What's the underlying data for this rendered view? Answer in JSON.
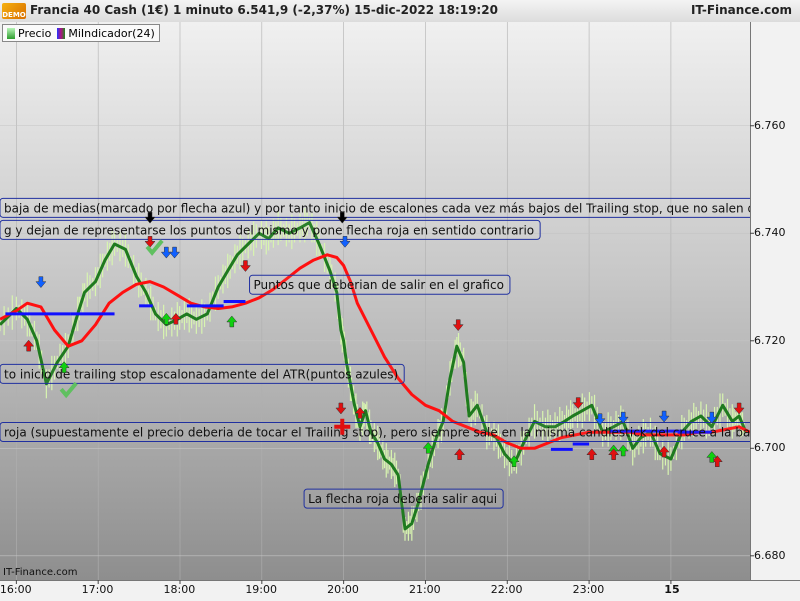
{
  "header": {
    "logo_text": "DEMO",
    "title": "Francia 40 Cash (1€) 1 minuto 6.541,9 (-2,37%) 15-dic-2022 18:19:20",
    "brand": "IT-Finance.com"
  },
  "legend": [
    {
      "label": "Precio",
      "swatch": "price-swatch-icon"
    },
    {
      "label": "MiIndicador(24)",
      "swatch": "indicator-swatch-icon"
    }
  ],
  "watermark": "IT-Finance.com",
  "colors": {
    "price": "#1f7a1f",
    "price_wick": "#d8f5b0",
    "ma": "#ff1010",
    "trailing": "#1010ff",
    "box_border": "#2030a0",
    "sell_arrow": "#e01010",
    "buy_arrow": "#10d010",
    "blue_arrow": "#1060ff"
  },
  "chart_data": {
    "type": "line",
    "title": "Francia 40 Cash (1€) 1 minuto",
    "y_ticks": [
      "6.760",
      "6.740",
      "6.720",
      "6.700",
      "6.680"
    ],
    "y_tick_values": [
      6760,
      6740,
      6720,
      6700,
      6680
    ],
    "ylim": [
      6675.5,
      6779.3
    ],
    "x_ticks": [
      "16:00",
      "17:00",
      "18:00",
      "19:00",
      "20:00",
      "21:00",
      "22:00",
      "23:00",
      "15"
    ],
    "x_tick_values": [
      960,
      1020,
      1080,
      1140,
      1200,
      1260,
      1320,
      1380,
      1440
    ],
    "x_bold_tick": "15",
    "xlim": [
      948,
      1498
    ],
    "series": [
      {
        "name": "Precio",
        "style": "thick-green-line",
        "x": [
          948,
          960,
          968,
          975,
          982,
          990,
          998,
          1005,
          1010,
          1018,
          1025,
          1032,
          1040,
          1048,
          1055,
          1062,
          1070,
          1078,
          1085,
          1092,
          1100,
          1108,
          1115,
          1122,
          1130,
          1138,
          1145,
          1152,
          1160,
          1168,
          1175,
          1182,
          1190,
          1195,
          1198,
          1200,
          1202,
          1205,
          1208,
          1212,
          1216,
          1220,
          1225,
          1230,
          1235,
          1240,
          1245,
          1250,
          1255,
          1262,
          1268,
          1273,
          1278,
          1283,
          1288,
          1292,
          1298,
          1305,
          1312,
          1318,
          1325,
          1332,
          1340,
          1348,
          1355,
          1362,
          1368,
          1375,
          1382,
          1390,
          1398,
          1405,
          1412,
          1418,
          1425,
          1432,
          1440,
          1448,
          1455,
          1462,
          1470,
          1478,
          1485,
          1490,
          1495
        ],
        "y": [
          6723,
          6726,
          6724,
          6720,
          6712,
          6716,
          6719,
          6725,
          6729,
          6731,
          6735,
          6738,
          6737,
          6732,
          6729,
          6725,
          6723,
          6724,
          6725,
          6724,
          6725,
          6730,
          6733,
          6736,
          6738,
          6740,
          6739,
          6741,
          6740,
          6741,
          6742,
          6738,
          6733,
          6729,
          6722,
          6720,
          6716,
          6712,
          6708,
          6704,
          6707,
          6703,
          6701,
          6698,
          6697,
          6695,
          6685,
          6686,
          6690,
          6697,
          6702,
          6705,
          6713,
          6719,
          6716,
          6706,
          6708,
          6703,
          6702,
          6699,
          6697,
          6701,
          6705,
          6704,
          6704,
          6705,
          6706,
          6707,
          6708,
          6703,
          6704,
          6705,
          6700,
          6702,
          6703,
          6699,
          6698,
          6703,
          6705,
          6706,
          6704,
          6708,
          6705,
          6706,
          6703
        ]
      },
      {
        "name": "MiIndicador(24)",
        "style": "red-moving-average",
        "x": [
          948,
          960,
          968,
          978,
          988,
          998,
          1008,
          1018,
          1028,
          1038,
          1048,
          1058,
          1068,
          1078,
          1088,
          1098,
          1108,
          1118,
          1128,
          1138,
          1148,
          1158,
          1168,
          1178,
          1188,
          1195,
          1200,
          1205,
          1210,
          1220,
          1230,
          1240,
          1250,
          1260,
          1270,
          1280,
          1290,
          1300,
          1310,
          1320,
          1330,
          1340,
          1350,
          1360,
          1370,
          1380,
          1390,
          1400,
          1410,
          1420,
          1430,
          1440,
          1450,
          1460,
          1470,
          1480,
          1490,
          1498
        ],
        "y": [
          6724,
          6725.6,
          6727,
          6726.3,
          6722,
          6719,
          6720,
          6723,
          6727,
          6729,
          6730.5,
          6731,
          6730,
          6728.5,
          6727,
          6726.3,
          6726,
          6726.3,
          6727,
          6728,
          6729.5,
          6731.5,
          6733.5,
          6735,
          6736,
          6735.5,
          6734,
          6731,
          6727,
          6722,
          6717,
          6713,
          6710,
          6708,
          6707,
          6705,
          6704,
          6703,
          6702.5,
          6701,
          6700,
          6700,
          6701,
          6702,
          6702.5,
          6703,
          6703,
          6703,
          6703,
          6702.5,
          6702.5,
          6702.5,
          6702.5,
          6703,
          6703,
          6703.5,
          6704,
          6703
        ]
      }
    ],
    "trailing_stop_segments": [
      [
        [
          952,
          6725
        ],
        [
          1000,
          6725
        ]
      ],
      [
        [
          1000,
          6725
        ],
        [
          1032,
          6725
        ]
      ],
      [
        [
          1050,
          6726.5
        ],
        [
          1060,
          6726.5
        ]
      ],
      [
        [
          1085,
          6726.5
        ],
        [
          1112,
          6726.5
        ]
      ],
      [
        [
          1112,
          6727.3
        ],
        [
          1128,
          6727.3
        ]
      ],
      [
        [
          1395,
          6703.2
        ],
        [
          1450,
          6703.2
        ]
      ],
      [
        [
          1352,
          6699.8
        ],
        [
          1368,
          6699.8
        ]
      ],
      [
        [
          1368,
          6700.8
        ],
        [
          1380,
          6700.8
        ]
      ],
      [
        [
          1445,
          6703
        ],
        [
          1470,
          6703
        ]
      ]
    ],
    "annotations": [
      {
        "text": "baja de medias(marcado por flecha azul) y por tanto inicio de escalones cada vez más bajos del Trailing stop, que no salen dibujados¿?",
        "x": 948,
        "y": 6746.5
      },
      {
        "text": "g y dejan de representarse los puntos del mismo y pone flecha roja en sentido contrario",
        "x": 948,
        "y": 6742.4
      },
      {
        "text": "Puntos que deberian de salir en el grafico",
        "x": 1131,
        "y": 6732.2
      },
      {
        "text": "to inicio de trailing stop escalonadamente del ATR(puntos azules)",
        "x": 948,
        "y": 6715.6
      },
      {
        "text": "roja (supuestamente el precio deberia de tocar el Trailing stop), pero siempre sale en la misma candlestick del cruce a la baja)",
        "x": 948,
        "y": 6704.8
      },
      {
        "text": "La flecha roja deberia salir aqui",
        "x": 1171,
        "y": 6692.4
      }
    ],
    "signals": [
      {
        "kind": "blue-down",
        "x": 978,
        "y": 6731
      },
      {
        "kind": "red-up",
        "x": 969,
        "y": 6719
      },
      {
        "kind": "green-up",
        "x": 995,
        "y": 6715
      },
      {
        "kind": "check",
        "x": 998,
        "y": 6711
      },
      {
        "kind": "black-down",
        "x": 1058,
        "y": 6743
      },
      {
        "kind": "red-down",
        "x": 1058,
        "y": 6738.5
      },
      {
        "kind": "check",
        "x": 1061,
        "y": 6737.5
      },
      {
        "kind": "blue-down",
        "x": 1070,
        "y": 6736.5
      },
      {
        "kind": "blue-down",
        "x": 1076,
        "y": 6736.5
      },
      {
        "kind": "green-up",
        "x": 1070,
        "y": 6724
      },
      {
        "kind": "red-up",
        "x": 1077,
        "y": 6724
      },
      {
        "kind": "red-down",
        "x": 1128,
        "y": 6734
      },
      {
        "kind": "green-up",
        "x": 1118,
        "y": 6723.5
      },
      {
        "kind": "black-down",
        "x": 1199,
        "y": 6743
      },
      {
        "kind": "blue-down",
        "x": 1201,
        "y": 6738.5
      },
      {
        "kind": "red-down",
        "x": 1198,
        "y": 6707.5
      },
      {
        "kind": "red-cross",
        "x": 1199,
        "y": 6704
      },
      {
        "kind": "red-up",
        "x": 1212,
        "y": 6706.5
      },
      {
        "kind": "green-up",
        "x": 1262,
        "y": 6700
      },
      {
        "kind": "red-down",
        "x": 1284,
        "y": 6723
      },
      {
        "kind": "red-up",
        "x": 1285,
        "y": 6698.8
      },
      {
        "kind": "green-up",
        "x": 1325,
        "y": 6697.5
      },
      {
        "kind": "red-down",
        "x": 1372,
        "y": 6708.5
      },
      {
        "kind": "blue-down",
        "x": 1388,
        "y": 6705.5
      },
      {
        "kind": "blue-down",
        "x": 1405,
        "y": 6705.8
      },
      {
        "kind": "green-up",
        "x": 1398,
        "y": 6699.5
      },
      {
        "kind": "green-up",
        "x": 1405,
        "y": 6699.5
      },
      {
        "kind": "red-up",
        "x": 1382,
        "y": 6698.8
      },
      {
        "kind": "red-up",
        "x": 1398,
        "y": 6698.8
      },
      {
        "kind": "blue-down",
        "x": 1435,
        "y": 6706
      },
      {
        "kind": "red-up",
        "x": 1435,
        "y": 6699.3
      },
      {
        "kind": "blue-down",
        "x": 1470,
        "y": 6705.8
      },
      {
        "kind": "red-down",
        "x": 1490,
        "y": 6707.5
      },
      {
        "kind": "red-up",
        "x": 1474,
        "y": 6697.5
      },
      {
        "kind": "green-up",
        "x": 1470,
        "y": 6698.3
      }
    ]
  }
}
